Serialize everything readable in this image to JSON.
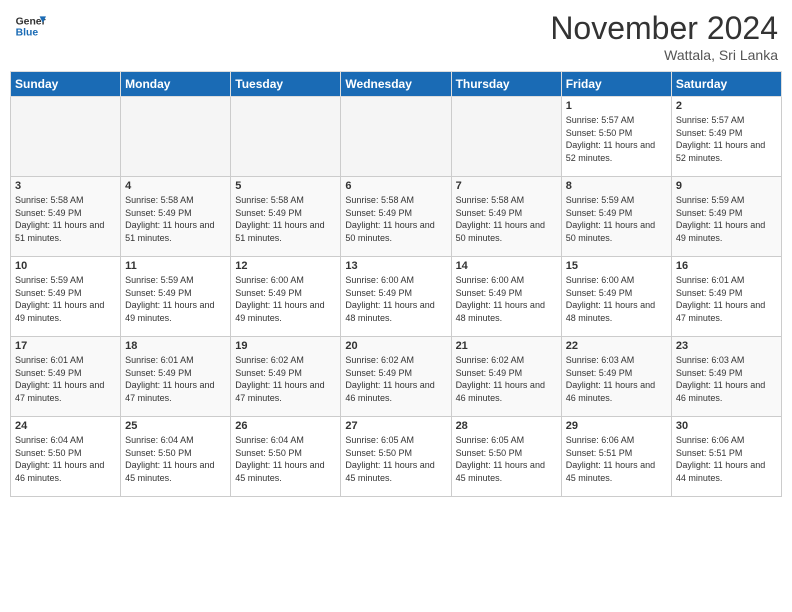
{
  "header": {
    "logo_line1": "General",
    "logo_line2": "Blue",
    "month_year": "November 2024",
    "location": "Wattala, Sri Lanka"
  },
  "weekdays": [
    "Sunday",
    "Monday",
    "Tuesday",
    "Wednesday",
    "Thursday",
    "Friday",
    "Saturday"
  ],
  "weeks": [
    [
      {
        "day": "",
        "empty": true
      },
      {
        "day": "",
        "empty": true
      },
      {
        "day": "",
        "empty": true
      },
      {
        "day": "",
        "empty": true
      },
      {
        "day": "",
        "empty": true
      },
      {
        "day": "1",
        "sunrise": "5:57 AM",
        "sunset": "5:50 PM",
        "daylight": "11 hours and 52 minutes."
      },
      {
        "day": "2",
        "sunrise": "5:57 AM",
        "sunset": "5:49 PM",
        "daylight": "11 hours and 52 minutes."
      }
    ],
    [
      {
        "day": "3",
        "sunrise": "5:58 AM",
        "sunset": "5:49 PM",
        "daylight": "11 hours and 51 minutes."
      },
      {
        "day": "4",
        "sunrise": "5:58 AM",
        "sunset": "5:49 PM",
        "daylight": "11 hours and 51 minutes."
      },
      {
        "day": "5",
        "sunrise": "5:58 AM",
        "sunset": "5:49 PM",
        "daylight": "11 hours and 51 minutes."
      },
      {
        "day": "6",
        "sunrise": "5:58 AM",
        "sunset": "5:49 PM",
        "daylight": "11 hours and 50 minutes."
      },
      {
        "day": "7",
        "sunrise": "5:58 AM",
        "sunset": "5:49 PM",
        "daylight": "11 hours and 50 minutes."
      },
      {
        "day": "8",
        "sunrise": "5:59 AM",
        "sunset": "5:49 PM",
        "daylight": "11 hours and 50 minutes."
      },
      {
        "day": "9",
        "sunrise": "5:59 AM",
        "sunset": "5:49 PM",
        "daylight": "11 hours and 49 minutes."
      }
    ],
    [
      {
        "day": "10",
        "sunrise": "5:59 AM",
        "sunset": "5:49 PM",
        "daylight": "11 hours and 49 minutes."
      },
      {
        "day": "11",
        "sunrise": "5:59 AM",
        "sunset": "5:49 PM",
        "daylight": "11 hours and 49 minutes."
      },
      {
        "day": "12",
        "sunrise": "6:00 AM",
        "sunset": "5:49 PM",
        "daylight": "11 hours and 49 minutes."
      },
      {
        "day": "13",
        "sunrise": "6:00 AM",
        "sunset": "5:49 PM",
        "daylight": "11 hours and 48 minutes."
      },
      {
        "day": "14",
        "sunrise": "6:00 AM",
        "sunset": "5:49 PM",
        "daylight": "11 hours and 48 minutes."
      },
      {
        "day": "15",
        "sunrise": "6:00 AM",
        "sunset": "5:49 PM",
        "daylight": "11 hours and 48 minutes."
      },
      {
        "day": "16",
        "sunrise": "6:01 AM",
        "sunset": "5:49 PM",
        "daylight": "11 hours and 47 minutes."
      }
    ],
    [
      {
        "day": "17",
        "sunrise": "6:01 AM",
        "sunset": "5:49 PM",
        "daylight": "11 hours and 47 minutes."
      },
      {
        "day": "18",
        "sunrise": "6:01 AM",
        "sunset": "5:49 PM",
        "daylight": "11 hours and 47 minutes."
      },
      {
        "day": "19",
        "sunrise": "6:02 AM",
        "sunset": "5:49 PM",
        "daylight": "11 hours and 47 minutes."
      },
      {
        "day": "20",
        "sunrise": "6:02 AM",
        "sunset": "5:49 PM",
        "daylight": "11 hours and 46 minutes."
      },
      {
        "day": "21",
        "sunrise": "6:02 AM",
        "sunset": "5:49 PM",
        "daylight": "11 hours and 46 minutes."
      },
      {
        "day": "22",
        "sunrise": "6:03 AM",
        "sunset": "5:49 PM",
        "daylight": "11 hours and 46 minutes."
      },
      {
        "day": "23",
        "sunrise": "6:03 AM",
        "sunset": "5:49 PM",
        "daylight": "11 hours and 46 minutes."
      }
    ],
    [
      {
        "day": "24",
        "sunrise": "6:04 AM",
        "sunset": "5:50 PM",
        "daylight": "11 hours and 46 minutes."
      },
      {
        "day": "25",
        "sunrise": "6:04 AM",
        "sunset": "5:50 PM",
        "daylight": "11 hours and 45 minutes."
      },
      {
        "day": "26",
        "sunrise": "6:04 AM",
        "sunset": "5:50 PM",
        "daylight": "11 hours and 45 minutes."
      },
      {
        "day": "27",
        "sunrise": "6:05 AM",
        "sunset": "5:50 PM",
        "daylight": "11 hours and 45 minutes."
      },
      {
        "day": "28",
        "sunrise": "6:05 AM",
        "sunset": "5:50 PM",
        "daylight": "11 hours and 45 minutes."
      },
      {
        "day": "29",
        "sunrise": "6:06 AM",
        "sunset": "5:51 PM",
        "daylight": "11 hours and 45 minutes."
      },
      {
        "day": "30",
        "sunrise": "6:06 AM",
        "sunset": "5:51 PM",
        "daylight": "11 hours and 44 minutes."
      }
    ]
  ]
}
